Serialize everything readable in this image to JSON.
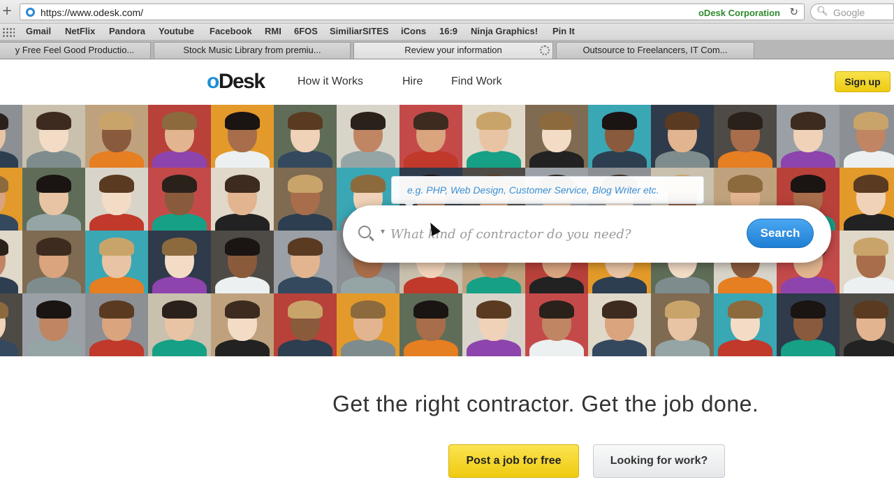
{
  "browser": {
    "url": "https://www.odesk.com/",
    "site_identity": "oDesk Corporation",
    "search_engine": "Google",
    "bookmarks": [
      "Gmail",
      "NetFlix",
      "Pandora",
      "Youtube",
      "Facebook",
      "RMI",
      "6FOS",
      "SimiliarSITES",
      "iCons",
      "16:9",
      "Ninja Graphics!",
      "Pin It"
    ],
    "tabs": [
      {
        "label": "y Free Feel Good Productio...",
        "active": false
      },
      {
        "label": "Stock Music Library from premiu...",
        "active": false
      },
      {
        "label": "Review your information",
        "active": true
      },
      {
        "label": "Outsource to Freelancers, IT Com...",
        "active": false
      }
    ]
  },
  "header": {
    "logo_o": "o",
    "logo_rest": "Desk",
    "nav": [
      "How it Works",
      "Hire",
      "Find Work"
    ],
    "signup_label": "Sign up"
  },
  "search": {
    "hint": "e.g. PHP, Web Design, Customer Service, Blog Writer etc.",
    "placeholder": "What kind of contractor do you need?",
    "button_label": "Search"
  },
  "main": {
    "tagline": "Get the right contractor. Get the job done.",
    "post_job_label": "Post a job for free",
    "looking_label": "Looking for work?"
  },
  "colors": {
    "brand_blue": "#1d8fd6",
    "cta_yellow": "#f5d626",
    "search_button": "#2b8ae0"
  }
}
